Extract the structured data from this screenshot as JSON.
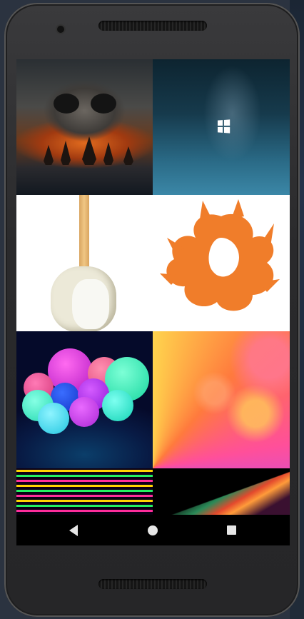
{
  "device": {
    "model_shape": "android-phone-frame"
  },
  "wallpapers": [
    {
      "name": "skull-ships-wallpaper",
      "palette": [
        "#2a2f33",
        "#e06a1e",
        "#121820"
      ]
    },
    {
      "name": "windows-logo-wallpaper",
      "palette": [
        "#0d2430",
        "#3b87a7",
        "#ffffff"
      ]
    },
    {
      "name": "white-guitar-wallpaper",
      "palette": [
        "#ffffff",
        "#ece9d8",
        "#d9a560"
      ]
    },
    {
      "name": "orange-fox-wallpaper",
      "palette": [
        "#ffffff",
        "#f07d2a"
      ]
    },
    {
      "name": "neon-balls-wallpaper",
      "palette": [
        "#050a2a",
        "#2df5c0",
        "#d41ad8"
      ]
    },
    {
      "name": "light-rays-wallpaper",
      "palette": [
        "#ff4f9a",
        "#9d4dff",
        "#ffd34d"
      ]
    },
    {
      "name": "neon-squares-wallpaper",
      "palette": [
        "#ff2d9b",
        "#23f060",
        "#ffd400"
      ]
    },
    {
      "name": "dark-streaks-wallpaper",
      "palette": [
        "#000000",
        "#2a8a58",
        "#e3492d"
      ]
    }
  ],
  "navigation": {
    "back_icon": "back-triangle-icon",
    "home_icon": "home-circle-icon",
    "recents_icon": "recents-square-icon"
  },
  "colors": {
    "screen_background": "#000000",
    "nav_icon": "#e6e6e6",
    "phone_body": "#2a2a2c"
  }
}
